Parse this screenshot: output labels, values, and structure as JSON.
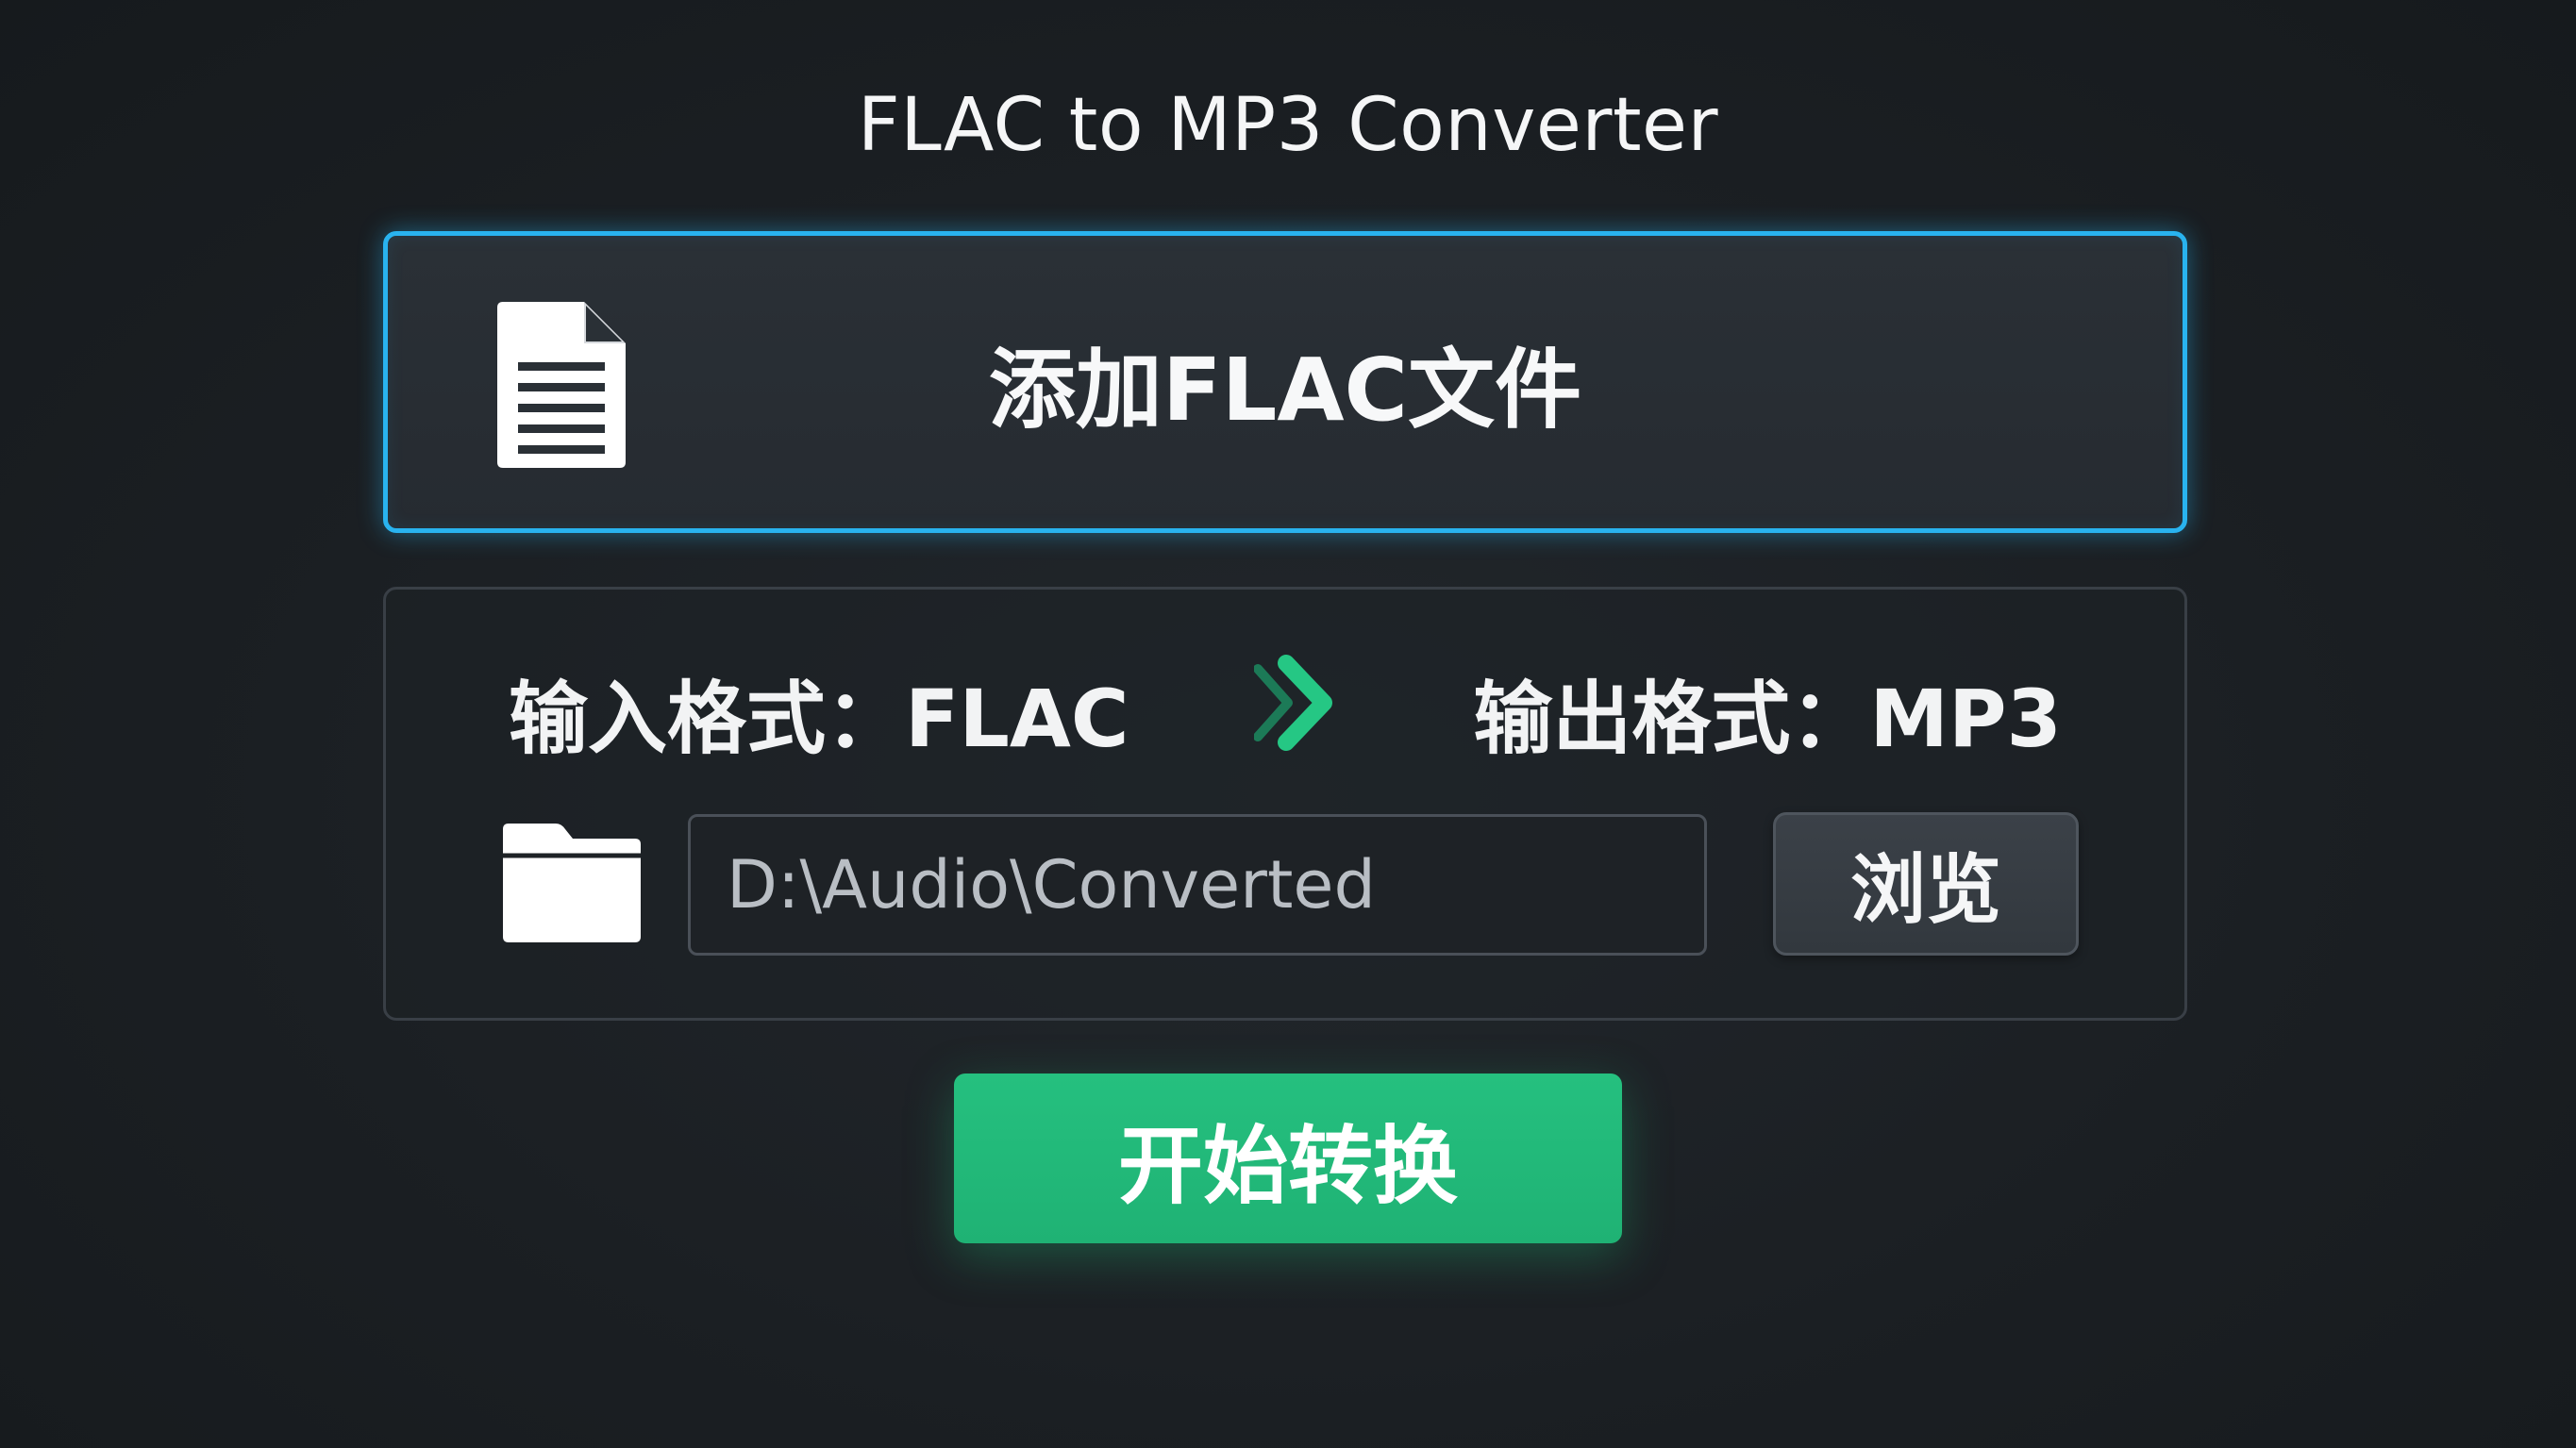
{
  "app": {
    "title": "FLAC to MP3 Converter"
  },
  "add_files": {
    "label": "添加FLAC文件",
    "icon": "document-icon"
  },
  "formats": {
    "input_label": "输入格式：FLAC",
    "output_label": "输出格式：MP3",
    "arrow_icon": "chevron-right-icon"
  },
  "output_folder": {
    "icon": "folder-icon",
    "path_value": "D:\\Audio\\Converted",
    "browse_label": "浏览"
  },
  "actions": {
    "start_label": "开始转换"
  },
  "colors": {
    "accent_blue": "#29b3ef",
    "accent_green": "#1fb274",
    "background": "#1b1f23"
  }
}
